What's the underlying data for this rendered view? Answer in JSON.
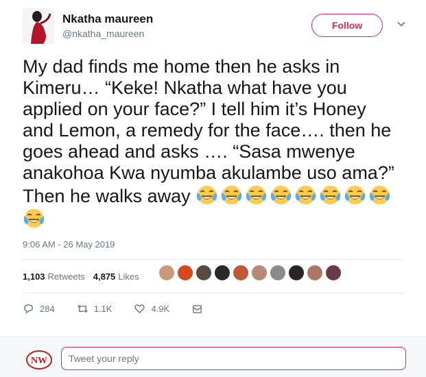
{
  "author": {
    "name": "Nkatha maureen",
    "handle": "@nkatha_maureen",
    "follow_label": "Follow"
  },
  "tweet": {
    "lines": [
      "My dad finds me home then he asks in",
      "Kimeru… “Keke! Nkatha what have you",
      "applied on your face?” I tell him it’s Honey",
      "and Lemon, a remedy for the face…. then he",
      "goes ahead and asks …. “Sasa mwenye",
      "anakohoa Kwa nyumba akulambe uso ama?”",
      "Then he walks away"
    ],
    "emoji_name": "face-with-tears-of-joy",
    "emoji_count": 9
  },
  "timestamp": "9:06 AM - 26 May 2019",
  "stats": {
    "retweets_count": "1,103",
    "retweets_label": "Retweets",
    "likes_count": "4,875",
    "likes_label": "Likes"
  },
  "actions": {
    "replies": "284",
    "retweets": "1.1K",
    "likes": "4.9K"
  },
  "reply": {
    "placeholder": "Tweet your reply",
    "logo_text": "NW"
  },
  "colors": {
    "accent": "#e0245e",
    "secondary_text": "#657786",
    "divider": "#e6ecf0"
  }
}
